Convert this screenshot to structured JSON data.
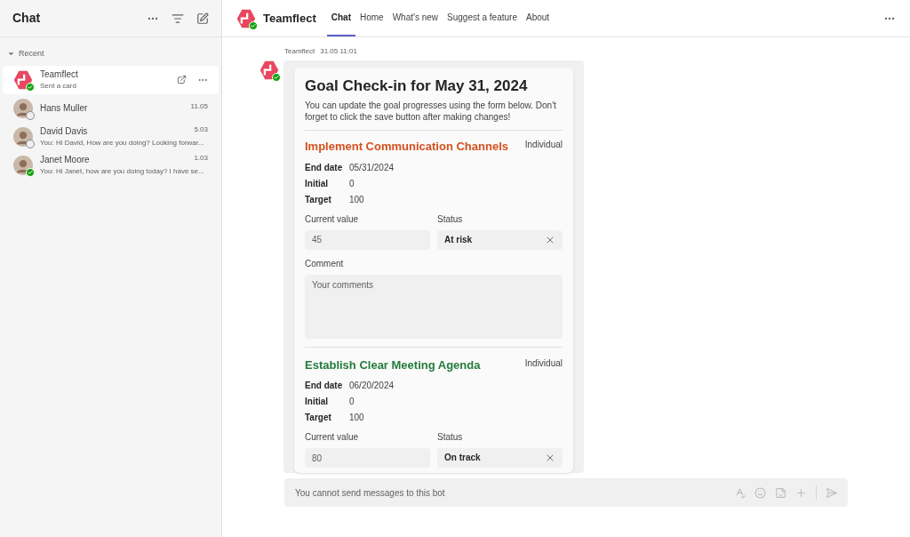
{
  "sidebar": {
    "title": "Chat",
    "section": "Recent",
    "chats": [
      {
        "name": "Teamflect",
        "preview": "Sent a card",
        "kind": "bot",
        "online": true,
        "selected": true
      },
      {
        "name": "Hans Muller",
        "time": "11.05",
        "kind": "person",
        "online": false,
        "selected": false
      },
      {
        "name": "David Davis",
        "preview": "You: Hi David, How are you doing? Looking forwar...",
        "time": "5.03",
        "kind": "person",
        "online": false,
        "selected": false
      },
      {
        "name": "Janet Moore",
        "preview": "You: Hi Janet, how are you doing today? I have se...",
        "time": "1.03",
        "kind": "person",
        "online": true,
        "selected": false
      }
    ]
  },
  "header": {
    "app_name": "Teamflect",
    "tabs": [
      {
        "label": "Chat",
        "selected": true
      },
      {
        "label": "Home",
        "selected": false
      },
      {
        "label": "What's new",
        "selected": false
      },
      {
        "label": "Suggest a feature",
        "selected": false
      },
      {
        "label": "About",
        "selected": false
      }
    ]
  },
  "message": {
    "sender": "Teamflect",
    "time": "31.05 11:01",
    "card": {
      "title": "Goal Check-in for May 31, 2024",
      "intro": "You can update the goal progresses using the form below. Don't forget to click the save button after making changes!",
      "goals": [
        {
          "title": "Implement Communication Channels",
          "color": "#d4501e",
          "type": "Individual",
          "end_date_label": "End date",
          "end_date": "05/31/2024",
          "initial_label": "Initial",
          "initial": "0",
          "target_label": "Target",
          "target": "100",
          "current_label": "Current value",
          "current": "45",
          "status_label": "Status",
          "status": "At risk",
          "comment_label": "Comment",
          "comment_placeholder": "Your comments"
        },
        {
          "title": "Establish Clear Meeting Agenda",
          "color": "#237b3b",
          "type": "Individual",
          "end_date_label": "End date",
          "end_date": "06/20/2024",
          "initial_label": "Initial",
          "initial": "0",
          "target_label": "Target",
          "target": "100",
          "current_label": "Current value",
          "current": "80",
          "status_label": "Status",
          "status": "On track"
        }
      ]
    }
  },
  "composer": {
    "placeholder": "You cannot send messages to this bot"
  }
}
